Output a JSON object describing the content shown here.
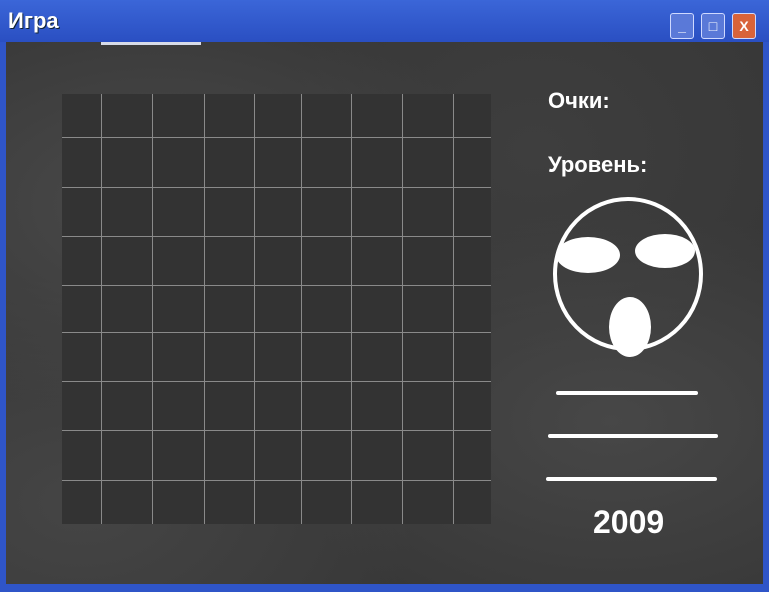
{
  "window": {
    "title": "Игра",
    "buttons": {
      "minimize": "_",
      "maximize": "□",
      "close": "X"
    }
  },
  "panel": {
    "score_label": "Очки:",
    "level_label": "Уровень:",
    "year": "2009"
  },
  "grid": {
    "columns": 9,
    "rows": 9
  }
}
